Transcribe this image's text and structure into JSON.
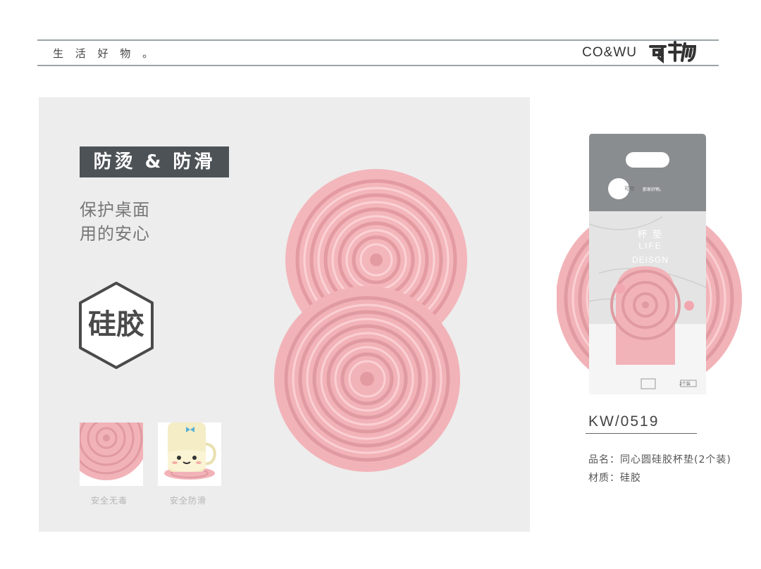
{
  "header": {
    "tagline": "生 活 好 物 。",
    "brand_name": "CO&WU",
    "brand_logo_text": "可物"
  },
  "hero": {
    "feature_title": "防烫 & 防滑",
    "benefit_line1": "保护桌面",
    "benefit_line2": "用的安心",
    "material_badge": "硅胶"
  },
  "thumbnails": [
    {
      "caption": "安全无毒"
    },
    {
      "caption": "安全防滑"
    }
  ],
  "package": {
    "card_logo": "可物",
    "card_slogan": "那家好物。",
    "label_cn": "杯 垫",
    "label_en1": "LIFE",
    "label_en2": "DEISGN",
    "count_tag": "2个装"
  },
  "product": {
    "sku": "KW/0519",
    "name_label": "品名：",
    "name_value": "同心圆硅胶杯垫(2个装)",
    "material_label": "材质：",
    "material_value": "硅胶"
  },
  "colors": {
    "coaster_pink": "#f2b3b8",
    "badge_dark": "#4c5256",
    "panel_bg": "#ededed"
  }
}
